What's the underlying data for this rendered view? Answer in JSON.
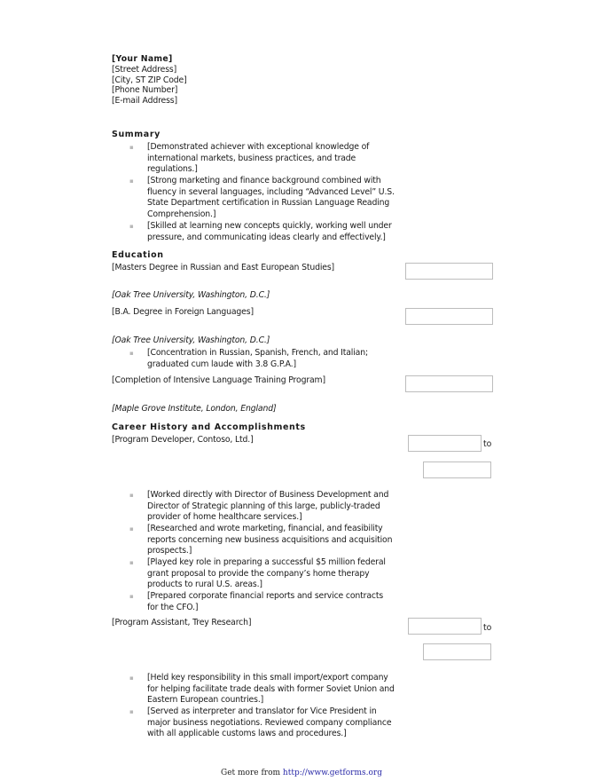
{
  "header": {
    "name": "[Your Name]",
    "street": "[Street Address]",
    "city": "[City, ST ZIP Code]",
    "phone": "[Phone Number]",
    "email": "[E-mail Address]"
  },
  "summary": {
    "heading": "Summary",
    "bullet_glyph": "▪",
    "bullets": [
      [
        "[Demonstrated achiever with exceptional knowledge of",
        "international markets, business practices, and trade",
        "regulations.]"
      ],
      [
        "[Strong marketing and finance background combined with",
        "fluency in several languages, including “Advanced Level” U.S.",
        "State Department certification in Russian Language Reading",
        "Comprehension.]"
      ],
      [
        "[Skilled at learning new concepts quickly, working well under",
        "pressure, and communicating ideas clearly and effectively.]"
      ]
    ]
  },
  "education": {
    "heading": "Education",
    "entries": [
      {
        "degree": "[Masters Degree in Russian  and East European Studies]",
        "school": "[Oak Tree University, Washington, D.C.]",
        "date": ""
      },
      {
        "degree": "[B.A. Degree in Foreign Languages]",
        "school": "[Oak Tree University, Washington, D.C.]",
        "date": "",
        "bullets": [
          [
            "[Concentration in Russian, Spanish, French, and Italian;",
            "graduated cum laude with 3.8 G.P.A.]"
          ]
        ]
      },
      {
        "degree": "[Completion of Intensive Language Training Program]",
        "school": "[Maple Grove Institute, London, England]",
        "date": ""
      }
    ]
  },
  "career": {
    "heading": "Career History and Accomplishments",
    "to_label": "to",
    "jobs": [
      {
        "title": "[Program Developer, Contoso, Ltd.]",
        "start": "",
        "end": "",
        "bullets": [
          [
            "[Worked directly with Director of Business Development and",
            "Director of Strategic planning of this large, publicly-traded",
            "provider of home healthcare services.]"
          ],
          [
            "[Researched and wrote marketing, financial, and feasibility",
            "reports concerning new business acquisitions and acquisition",
            "prospects.]"
          ],
          [
            "[Played key role in preparing a successful $5 million federal",
            "grant proposal to provide the company’s home therapy",
            "products to rural U.S. areas.]"
          ],
          [
            "[Prepared corporate financial reports and service contracts",
            "for the CFO.]"
          ]
        ]
      },
      {
        "title": "[Program Assistant, Trey Research]",
        "start": "",
        "end": "",
        "bullets": [
          [
            "[Held key responsibility in this small import/export company",
            "for helping facilitate trade deals with former Soviet Union and",
            "Eastern European countries.]"
          ],
          [
            "[Served as interpreter and translator for Vice President in",
            "major business negotiations. Reviewed company compliance",
            "with all applicable customs laws and procedures.]"
          ]
        ]
      }
    ]
  },
  "footer": {
    "prefix": "Get more from ",
    "link": "http://www.getforms.org"
  },
  "colors": {
    "text": "#1a1a1a",
    "field_border": "#bdbdbd",
    "bullet": "#b8b8b8",
    "link": "#2a2aa8"
  }
}
